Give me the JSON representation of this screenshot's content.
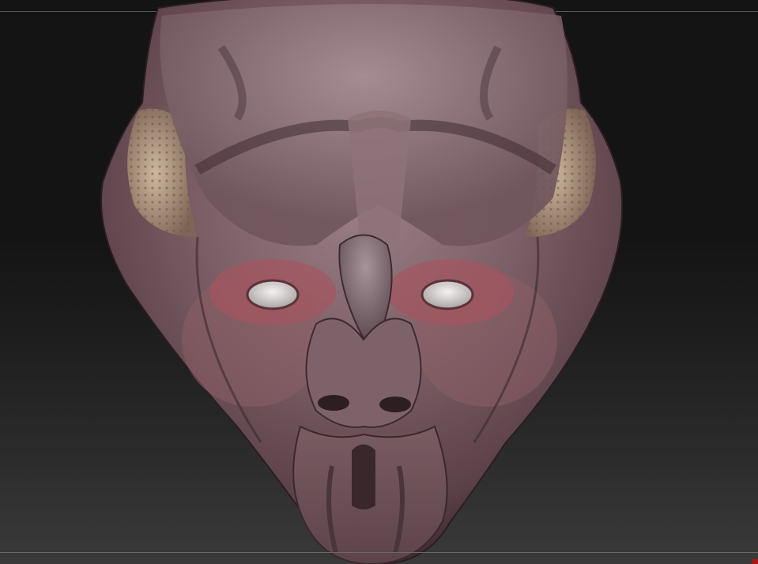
{
  "viewport": {
    "description_free": true,
    "background_colors": {
      "top": "#141414",
      "bottom": "#3a3a3a"
    },
    "guide_line_color": "#5a5a5a",
    "marker_color": "#b31212"
  },
  "model": {
    "skin_color": "#7e6068",
    "skin_highlight": "#a2878d",
    "skin_shadow": "#3d2b30",
    "ear_color": "#b9a48c",
    "eye_color": "#e7e3e3",
    "lid_color": "#b36068"
  }
}
